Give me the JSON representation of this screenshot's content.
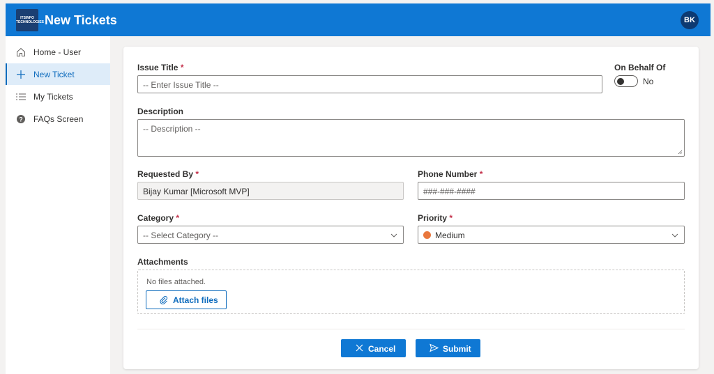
{
  "header": {
    "logo_text": "ITSINFO TECHNOLOGIES",
    "title": "New Tickets",
    "avatar_initials": "BK"
  },
  "sidebar": {
    "items": [
      {
        "label": "Home - User",
        "icon": "home-icon"
      },
      {
        "label": "New Ticket",
        "icon": "plus-icon",
        "active": true
      },
      {
        "label": "My Tickets",
        "icon": "list-icon"
      },
      {
        "label": "FAQs Screen",
        "icon": "question-icon"
      }
    ]
  },
  "form": {
    "issue_title": {
      "label": "Issue Title",
      "required": "*",
      "placeholder": "-- Enter Issue Title --"
    },
    "on_behalf": {
      "label": "On Behalf Of",
      "value": "No"
    },
    "description": {
      "label": "Description",
      "placeholder": "-- Description --"
    },
    "requested_by": {
      "label": "Requested By",
      "required": "*",
      "value": "Bijay Kumar [Microsoft MVP]"
    },
    "phone": {
      "label": "Phone Number",
      "required": "*",
      "placeholder": "###-###-####"
    },
    "category": {
      "label": "Category",
      "required": "*",
      "placeholder": "-- Select Category --"
    },
    "priority": {
      "label": "Priority",
      "required": "*",
      "value": "Medium",
      "color": "#e9773d"
    },
    "attachments": {
      "label": "Attachments",
      "empty_text": "No files attached.",
      "button": "Attach files"
    }
  },
  "actions": {
    "cancel": "Cancel",
    "submit": "Submit"
  },
  "colors": {
    "brand": "#0f78d4",
    "required": "#c4314b",
    "active_nav_bg": "#deecf9"
  }
}
